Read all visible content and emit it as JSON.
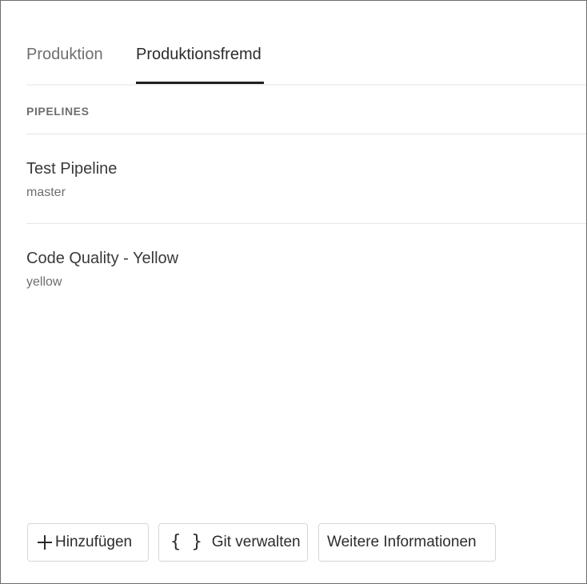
{
  "tabs": [
    {
      "label": "Produktion",
      "selected": false
    },
    {
      "label": "Produktionsfremd",
      "selected": true
    }
  ],
  "section": {
    "title": "PIPELINES"
  },
  "pipelines": [
    {
      "name": "Test Pipeline",
      "branch": "master"
    },
    {
      "name": "Code Quality - Yellow",
      "branch": "yellow"
    }
  ],
  "actions": {
    "add_label": "Hinzufügen",
    "add_icon": "plus-icon",
    "git_label": "Git verwalten",
    "git_icon": "braces-icon",
    "info_label": "Weitere Informationen"
  },
  "colors": {
    "selected_tab_underline": "#1f1f1f",
    "muted_text": "#6e6e6e",
    "divider": "#e6e6e6"
  }
}
